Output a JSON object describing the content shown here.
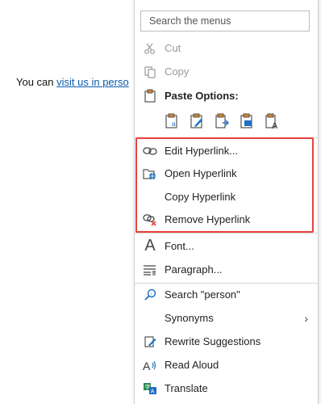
{
  "document": {
    "text_before": "You can ",
    "link_text": "visit us in perso"
  },
  "menu": {
    "search_placeholder": "Search the menus",
    "cut": "Cut",
    "copy": "Copy",
    "paste_options": "Paste Options:",
    "edit_hyperlink": "Edit Hyperlink...",
    "open_hyperlink": "Open Hyperlink",
    "copy_hyperlink": "Copy Hyperlink",
    "remove_hyperlink": "Remove Hyperlink",
    "font": "Font...",
    "paragraph": "Paragraph...",
    "search_person": "Search \"person\"",
    "synonyms": "Synonyms",
    "synonyms_chevron": "›",
    "rewrite": "Rewrite Suggestions",
    "read_aloud": "Read Aloud",
    "translate": "Translate",
    "font_icon_glyph": "A"
  },
  "colors": {
    "highlight_border": "#e8423a",
    "link": "#0b5cad",
    "icon_blue": "#1f6fc5",
    "icon_orange": "#d9822b"
  }
}
